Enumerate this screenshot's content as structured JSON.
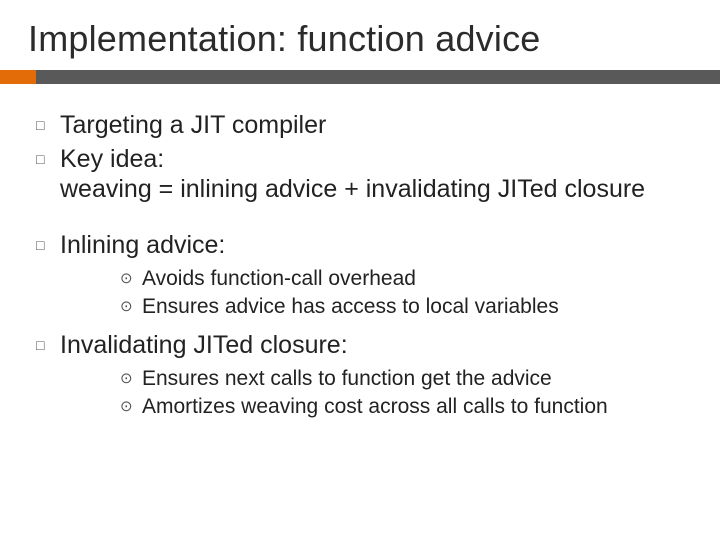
{
  "title": "Implementation: function advice",
  "bullets": [
    {
      "text": "Targeting a JIT compiler"
    },
    {
      "text": "Key idea:\nweaving = inlining advice + invalidating JITed closure"
    },
    {
      "text": "Inlining advice:",
      "gap": true,
      "sub": [
        "Avoids function-call overhead",
        "Ensures advice has access to local variables"
      ]
    },
    {
      "text": "Invalidating JITed closure:",
      "sub": [
        "Ensures next calls to function get the advice",
        "Amortizes weaving cost across all calls to function"
      ]
    }
  ]
}
